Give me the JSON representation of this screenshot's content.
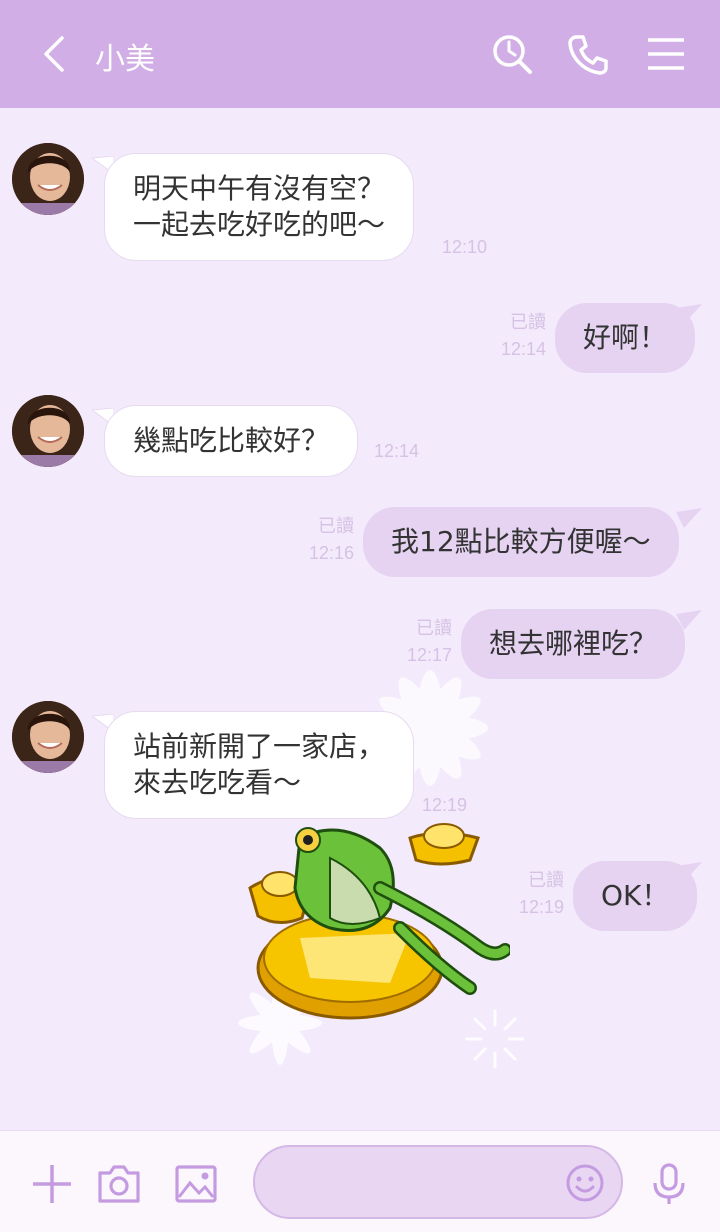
{
  "header": {
    "title": "小美",
    "background": "#d1aee6",
    "icons": [
      "back-chevron-icon",
      "search-clock-icon",
      "phone-icon",
      "menu-icon"
    ]
  },
  "messages": [
    {
      "dir": "in",
      "lines": [
        "明天中午有沒有空？",
        "一起去吃好吃的吧～"
      ],
      "time": "12:10"
    },
    {
      "dir": "out",
      "lines": [
        "好啊！"
      ],
      "read": "已讀",
      "time": "12:14"
    },
    {
      "dir": "in",
      "lines": [
        "幾點吃比較好？"
      ],
      "time": "12:14"
    },
    {
      "dir": "out",
      "lines": [
        "我12點比較方便喔～"
      ],
      "read": "已讀",
      "time": "12:16"
    },
    {
      "dir": "out",
      "lines": [
        "想去哪裡吃？"
      ],
      "read": "已讀",
      "time": "12:17"
    },
    {
      "dir": "in",
      "lines": [
        "站前新開了一家店，",
        "來去吃吃看～"
      ],
      "time": "12:19"
    },
    {
      "dir": "out",
      "lines": [
        "OK！"
      ],
      "read": "已讀",
      "time": "12:19"
    }
  ],
  "sticker": {
    "icon": "frog-on-gold-coins-sticker"
  },
  "footer": {
    "input_value": "",
    "icons": [
      "plus-icon",
      "camera-icon",
      "image-icon",
      "emoji-icon",
      "microphone-icon"
    ]
  },
  "colors": {
    "chat_bg": "#f3eafb",
    "bubble_out": "#e6d3f2",
    "bubble_in": "#ffffff",
    "meta_text": "#d6c2e4",
    "icon_color": "#c49be0"
  }
}
